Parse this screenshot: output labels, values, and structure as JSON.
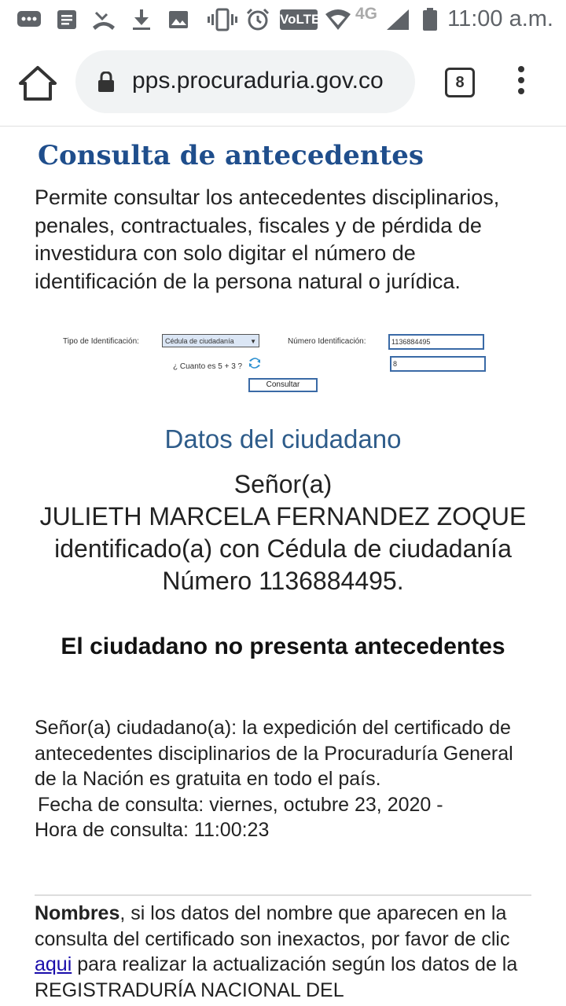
{
  "status_bar": {
    "time": "11:00 a.m.",
    "network": "4G",
    "volte": "VoLTE",
    "icons": [
      "chat-icon",
      "message-icon",
      "missed-call-icon",
      "download-icon",
      "image-icon",
      "vibrate-icon",
      "alarm-icon",
      "volte-icon",
      "wifi-icon",
      "signal-icon",
      "battery-icon"
    ]
  },
  "browser": {
    "url": "pps.procuraduria.gov.co",
    "tab_count": "8"
  },
  "page": {
    "title": "Consulta de antecedentes",
    "intro": "Permite consultar los antecedentes disciplinarios, penales, contractuales, fiscales y de pérdida de investidura con solo digitar el número de identificación de la persona natural o jurídica.",
    "form": {
      "id_type_label": "Tipo de Identificación:",
      "id_type_value": "Cédula de ciudadanía",
      "id_number_label": "Número Identificación:",
      "id_number_value": "1136884495",
      "captcha_question": "¿ Cuanto es 5 + 3 ?",
      "captcha_answer": "8",
      "submit_label": "Consultar"
    },
    "datos_heading": "Datos del ciudadano",
    "citizen": {
      "line1": "Señor(a)",
      "line2": "JULIETH MARCELA FERNANDEZ ZOQUE",
      "line3": "identificado(a) con Cédula de ciudadanía",
      "line4": "Número 1136884495."
    },
    "result": "El ciudadano no presenta antecedentes",
    "notice": {
      "text": "Señor(a) ciudadano(a): la expedición del certificado de antecedentes disciplinarios de la Procuraduría General de la Nación es gratuita en todo el país.",
      "fecha": "Fecha de consulta: viernes, octubre 23, 2020 -",
      "hora": "Hora de consulta: 11:00:23"
    },
    "nombres": {
      "bold": "Nombres",
      "text1": ", si los datos del nombre que aparecen en la consulta del certificado son inexactos, por favor de clic ",
      "link": "aqui",
      "text2": " para realizar la actualización según los datos de la REGISTRADURÍA NACIONAL DEL"
    }
  }
}
